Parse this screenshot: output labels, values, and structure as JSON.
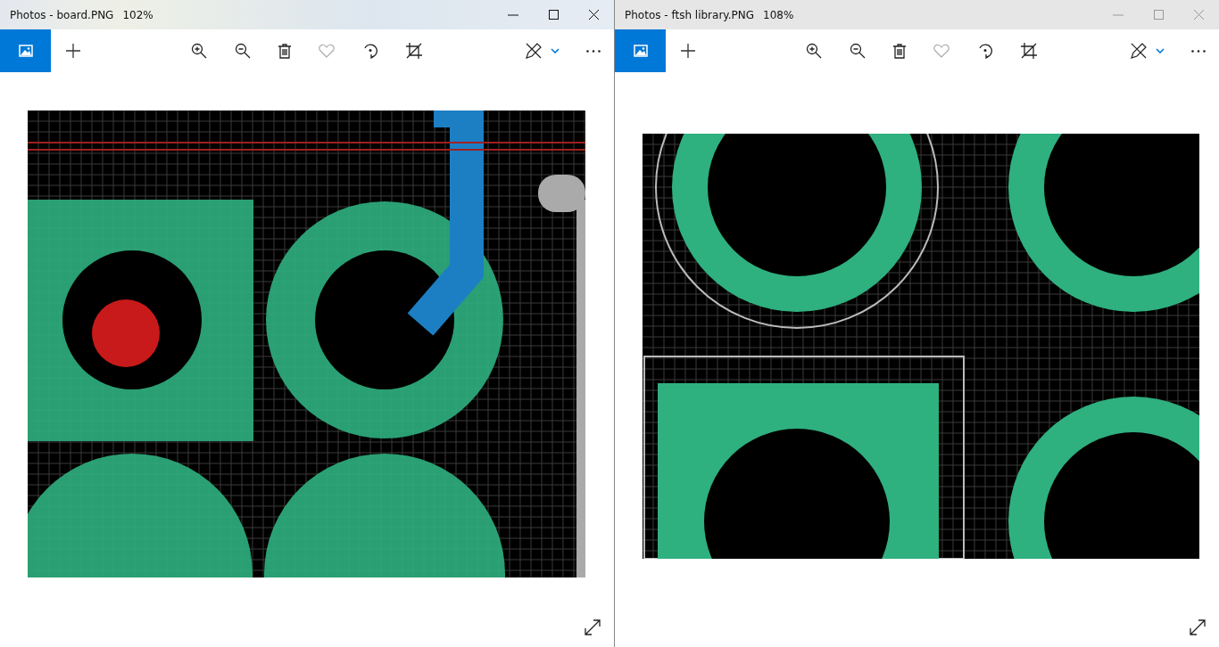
{
  "windows": [
    {
      "title": "Photos - board.PNG",
      "zoom": "102%",
      "active": true
    },
    {
      "title": "Photos - ftsh library.PNG",
      "zoom": "108%",
      "active": false
    }
  ]
}
